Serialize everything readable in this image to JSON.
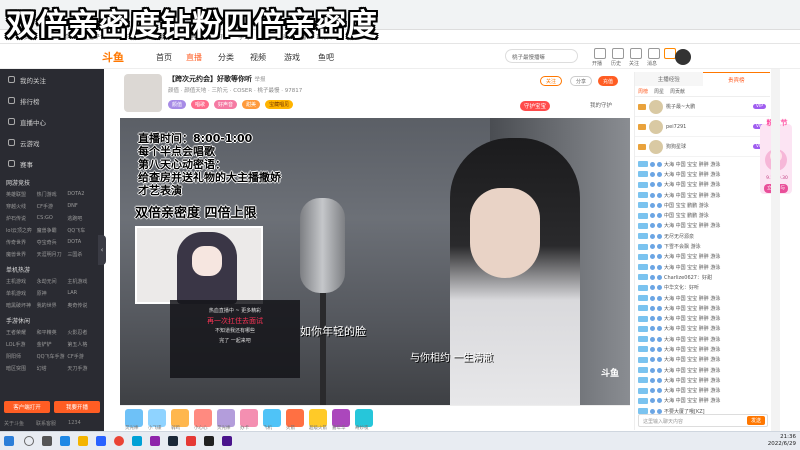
{
  "overlay_title": "双倍亲密度钻粉四倍亲密度",
  "browser": {
    "bookmarks": [
      "首页",
      "斗鱼 - 每个人的直播平台",
      "大屏",
      "视频",
      "提示",
      "哔哩哔哩",
      "问答",
      "学习",
      "搜狐",
      "斗鱼直播",
      "正版中心"
    ]
  },
  "topnav": {
    "logo": "斗鱼",
    "links": [
      "首页",
      "直播",
      "分类",
      "视频",
      "游戏",
      "鱼吧"
    ],
    "search_placeholder": "桃子最慢播嘛",
    "icons": [
      "开播",
      "历史",
      "关注",
      "消息",
      "任务"
    ]
  },
  "sidebar": {
    "items": [
      "我的关注",
      "排行榜",
      "直播中心",
      "云游戏",
      "赛事"
    ],
    "section1": {
      "title": "网游竞技",
      "items": [
        "英雄联盟",
        "热门游戏",
        "DOTA2",
        "穿越火线",
        "CF手游",
        "DNF",
        "炉石传说",
        "CS:GO",
        "逃跑吧",
        "lol云顶之弈",
        "魔兽争霸",
        "QQ飞车",
        "传奇世界",
        "夺宝奇兵",
        "DOTA",
        "魔兽世界",
        "天涯明月刀",
        "三国杀"
      ]
    },
    "section2": {
      "title": "单机热游",
      "items": [
        "主机游戏",
        "永劫无间",
        "主机游戏",
        "单机游戏",
        "原神",
        "LAR",
        "暗黑破坏神",
        "我的世界",
        "奥奇传说"
      ]
    },
    "section3": {
      "title": "手游休闲",
      "items": [
        "王者荣耀",
        "和平精英",
        "火影忍者",
        "LOL手游",
        "金铲铲",
        "第五人格",
        "阴阳师",
        "QQ飞车手游",
        "CF手游",
        "暗区突围",
        "幻塔",
        "天刀手游"
      ]
    },
    "btn_open": "客户端打开",
    "btn_pin": "我要开播",
    "footer": [
      "关于斗鱼",
      "联系客服",
      "1234"
    ]
  },
  "room": {
    "title": "【跨次元约会】好歌等你听",
    "report": "举报",
    "meta": "颜值 · 颜值天地 · 三阶元 · COSER",
    "streamer_name": "桃子最慢",
    "followers": "97817",
    "tags": [
      "颜值",
      "唱歌",
      "好声音",
      "甜美",
      "宝藏唱见"
    ],
    "btn_follow": "关注",
    "btn_share": "分享",
    "btn_gift": "充值",
    "right_text1": "守护宝宝",
    "right_text2": "我的守护"
  },
  "video": {
    "schedule": [
      "直播时间：8:00-1:00",
      "每个半点会唱歌",
      "第八天心动密语：",
      "给查房并送礼物的大主播撒娇",
      "才艺表演"
    ],
    "double_text": "双倍亲密度 四倍上限",
    "tv_lines": [
      "热血直播中 ~ 更多精彩",
      "再一次扛住去面试",
      "不知道我还有哪些",
      "完了 一起来吧"
    ],
    "lyric1": "如你年轻的脸",
    "lyric2": "与你相约 一生清澈",
    "douyu_mark": "斗鱼"
  },
  "gifts": [
    "荧光棒",
    "小飞碟",
    "弱鸡",
    "小心心",
    "荧光棒",
    "办卡",
    "飞机",
    "火箭",
    "超级火箭",
    "嘉年华",
    "奇妙夜"
  ],
  "chat": {
    "tabs": [
      "主播经验",
      "贵宾榜"
    ],
    "subtabs": [
      "周榜",
      "周星",
      "周贡献"
    ],
    "rank": [
      {
        "name": "桃子最~大鹏",
        "badge": "VIP"
      },
      {
        "name": "pei7291",
        "badge": "VIP"
      },
      {
        "name": "狗狗星球",
        "badge": "VIP"
      }
    ],
    "lines": [
      "大海 中国 宝宝 胖胖 游泳",
      "大海 中国 宝宝 胖胖 游泳",
      "大海 中国 宝宝 胖胖 游泳",
      "大海 中国 宝宝 胖胖 游泳",
      "中国 宝宝 鹏鹏 游泳",
      "中国 宝宝 鹏鹏 游泳",
      "大海 中国 宝宝 胖胖 游泳",
      "无尽无尽源泉",
      "下雪不会飘 游泳",
      "大海 中国 宝宝 胖胖 游泳",
      "大海 中国 宝宝 胖胖 游泳",
      "Charlize0627：好甜",
      "中华文化：好听",
      "大海 中国 宝宝 胖胖 游泳",
      "大海 中国 宝宝 胖胖 游泳",
      "大海 中国 宝宝 胖胖 游泳",
      "大海 中国 宝宝 胖胖 游泳",
      "大海 中国 宝宝 胖胖 游泳",
      "大海 中国 宝宝 胖胖 游泳",
      "大海 中国 宝宝 胖胖 游泳",
      "大海 中国 宝宝 胖胖 游泳",
      "大海 中国 宝宝 胖胖 游泳",
      "大海 中国 宝宝 胖胖 游泳",
      "大海 中国 宝宝 胖胖 游泳",
      "不要大厦了哦[KZ]"
    ],
    "input_placeholder": "这里输入聊天内容",
    "send_label": "发送"
  },
  "promo": {
    "title": "粉丝节",
    "date": "9.28-9.30",
    "btn": "立即参与"
  },
  "taskbar": {
    "time": "21:36",
    "date": "2022/6/29"
  }
}
